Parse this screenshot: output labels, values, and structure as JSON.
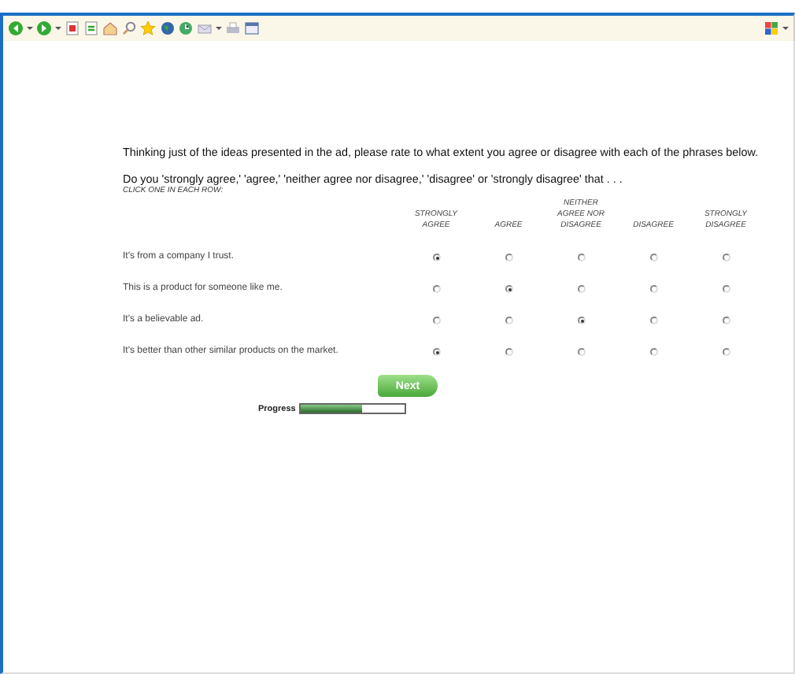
{
  "intro": "Thinking just of the ideas presented in the ad, please rate to what extent you agree or disagree with each of the phrases below.",
  "question": "Do you 'strongly agree,' 'agree,' 'neither agree nor disagree,' 'disagree' or 'strongly disagree' that . . .",
  "instruction": "CLICK ONE IN EACH ROW:",
  "columns": [
    "STRONGLY AGREE",
    "AGREE",
    "NEITHER AGREE NOR DISAGREE",
    "DISAGREE",
    "STRONGLY DISAGREE"
  ],
  "rows": [
    {
      "statement": "It's from a company I trust.",
      "choices": [
        {
          "selected": true
        },
        {
          "selected": false
        },
        {
          "selected": false
        },
        {
          "selected": false
        },
        {
          "selected": false
        }
      ]
    },
    {
      "statement": "This is a product for someone like me.",
      "choices": [
        {
          "selected": false
        },
        {
          "selected": true
        },
        {
          "selected": false
        },
        {
          "selected": false
        },
        {
          "selected": false
        }
      ]
    },
    {
      "statement": "It's a believable ad.",
      "choices": [
        {
          "selected": false
        },
        {
          "selected": false
        },
        {
          "selected": true
        },
        {
          "selected": false
        },
        {
          "selected": false
        }
      ]
    },
    {
      "statement": "It's better than other similar products on the market.",
      "choices": [
        {
          "selected": true
        },
        {
          "selected": false
        },
        {
          "selected": false
        },
        {
          "selected": false
        },
        {
          "selected": false
        }
      ]
    }
  ],
  "next_button": "Next",
  "progress": {
    "label": "Progress",
    "level": 0.6
  }
}
